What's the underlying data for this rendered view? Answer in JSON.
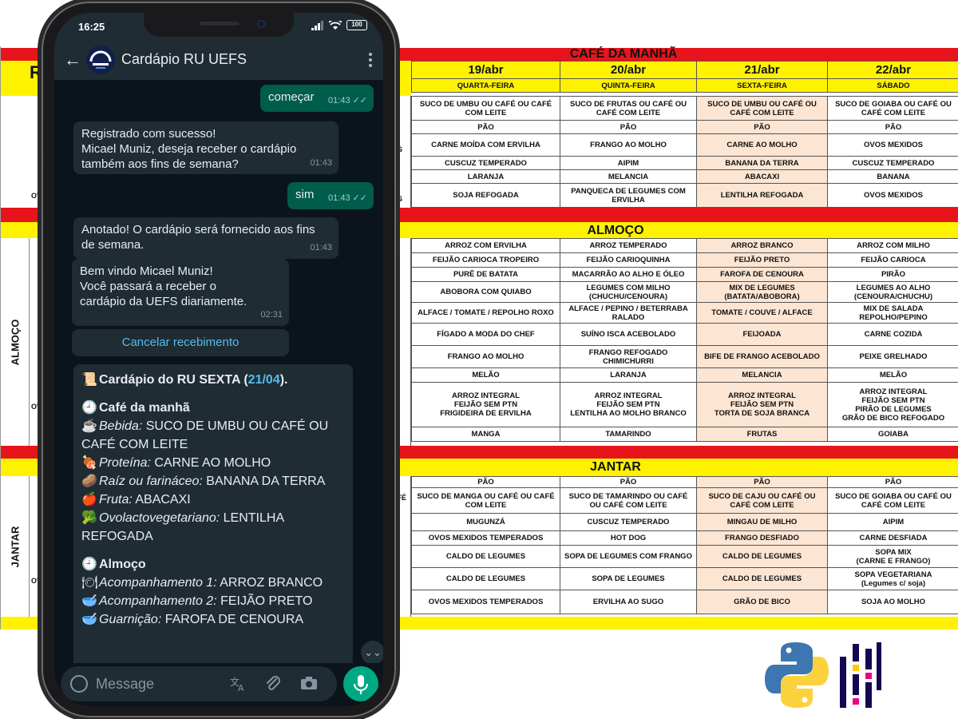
{
  "menu": {
    "r_letter": "R",
    "sections": {
      "breakfast": "CAFÉ DA MANHÃ",
      "lunch": "ALMOÇO",
      "dinner": "JANTAR"
    },
    "side_labels": {
      "lunch": "ALMOÇO",
      "dinner": "JANTAR"
    },
    "left_stubs": {
      "s1": "OS",
      "s2": "OS",
      "s3": "OV",
      "s4": "A",
      "s5": "OV",
      "s6": "AFÉ",
      "s7": "OV",
      "s8": "OV",
      "s9": "E"
    },
    "days": [
      {
        "date": "19/abr",
        "weekday": "QUARTA-FEIRA"
      },
      {
        "date": "20/abr",
        "weekday": "QUINTA-FEIRA"
      },
      {
        "date": "21/abr",
        "weekday": "SEXTA-FEIRA"
      },
      {
        "date": "22/abr",
        "weekday": "SÁBADO"
      }
    ],
    "breakfast_rows": [
      [
        "SUCO DE UMBU OU CAFÉ OU CAFÉ\nCOM LEITE",
        "SUCO DE FRUTAS OU CAFÉ OU\nCAFÉ COM LEITE",
        "SUCO DE UMBU OU CAFÉ OU\nCAFÉ COM LEITE",
        "SUCO DE GOIABA OU CAFÉ OU\nCAFÉ COM LEITE"
      ],
      [
        "PÃO",
        "PÃO",
        "PÃO",
        "PÃO"
      ],
      [
        "CARNE MOÍDA COM ERVILHA",
        "FRANGO AO MOLHO",
        "CARNE AO MOLHO",
        "OVOS MEXIDOS"
      ],
      [
        "CUSCUZ TEMPERADO",
        "AIPIM",
        "BANANA DA TERRA",
        "CUSCUZ TEMPERADO"
      ],
      [
        "LARANJA",
        "MELANCIA",
        "ABACAXI",
        "BANANA"
      ],
      [
        "SOJA REFOGADA",
        "PANQUECA DE LEGUMES COM\nERVILHA",
        "LENTILHA REFOGADA",
        "OVOS MEXIDOS"
      ]
    ],
    "lunch_rows": [
      [
        "ARROZ COM ERVILHA",
        "ARROZ TEMPERADO",
        "ARROZ BRANCO",
        "ARROZ COM MILHO"
      ],
      [
        "FEIJÃO CARIOCA TROPEIRO",
        "FEIJÃO CARIOQUINHA",
        "FEIJÃO PRETO",
        "FEIJÃO CARIOCA"
      ],
      [
        "PURÊ DE BATATA",
        "MACARRÃO AO ALHO E ÓLEO",
        "FAROFA DE CENOURA",
        "PIRÃO"
      ],
      [
        "ABOBORA COM QUIABO",
        "LEGUMES COM MILHO\n(CHUCHU/CENOURA)",
        "MIX DE LEGUMES\n(BATATA/ABOBORA)",
        "LEGUMES AO ALHO\n(CENOURA/CHUCHU)"
      ],
      [
        "ALFACE / TOMATE / REPOLHO ROXO",
        "ALFACE / PEPINO / BETERRABA\nRALADO",
        "TOMATE / COUVE / ALFACE",
        "MIX DE SALADA\nREPOLHO/PEPINO"
      ],
      [
        "FÍGADO A MODA DO CHEF",
        "SUÍNO ISCA ACEBOLADO",
        "FEIJOADA",
        "CARNE COZIDA"
      ],
      [
        "FRANGO AO MOLHO",
        "FRANGO REFOGADO\nCHIMICHURRI",
        "BIFE DE FRANGO ACEBOLADO",
        "PEIXE GRELHADO"
      ],
      [
        "MELÃO",
        "LARANJA",
        "MELANCIA",
        "MELÃO"
      ],
      [
        "ARROZ INTEGRAL\nFEIJÃO SEM PTN\nFRIGIDEIRA DE ERVILHA",
        "ARROZ INTEGRAL\nFEIJÃO SEM PTN\nLENTILHA AO MOLHO BRANCO",
        "ARROZ INTEGRAL\nFEIJÃO SEM PTN\nTORTA DE SOJA BRANCA",
        "ARROZ INTEGRAL\nFEIJÃO SEM PTN\nPIRÃO DE LEGUMES\nGRÃO DE BICO REFOGADO"
      ],
      [
        "MANGA",
        "TAMARINDO",
        "FRUTAS",
        "GOIABA"
      ]
    ],
    "dinner_rows": [
      [
        "PÃO",
        "PÃO",
        "PÃO",
        "PÃO"
      ],
      [
        "SUCO DE MANGA OU CAFÉ OU CAFÉ\nCOM LEITE",
        "SUCO DE TAMARINDO OU CAFÉ\nOU CAFÉ COM LEITE",
        "SUCO DE CAJU OU CAFÉ OU\nCAFÉ COM LEITE",
        "SUCO DE GOIABA OU CAFÉ OU\nCAFÉ COM LEITE"
      ],
      [
        "MUGUNZÁ",
        "CUSCUZ TEMPERADO",
        "MINGAU DE MILHO",
        "AIPIM"
      ],
      [
        "OVOS MEXIDOS TEMPERADOS",
        "HOT DOG",
        "FRANGO DESFIADO",
        "CARNE DESFIADA"
      ],
      [
        "CALDO DE LEGUMES",
        "SOPA DE LEGUMES COM FRANGO",
        "CALDO DE LEGUMES",
        "SOPA MIX\n(CARNE E FRANGO)"
      ],
      [
        "CALDO DE LEGUMES",
        "SOPA DE LEGUMES",
        "CALDO DE LEGUMES",
        "SOPA VEGETARIANA\n(Legumes c/ soja)"
      ],
      [
        "OVOS MEXIDOS TEMPERADOS",
        "ERVILHA AO SUGO",
        "GRÃO DE BICO",
        "SOJA AO MOLHO"
      ]
    ]
  },
  "phone": {
    "status": {
      "time": "16:25",
      "battery": "100"
    },
    "appbar": {
      "title": "Cardápio RU UEFS"
    },
    "messages": [
      {
        "dir": "out",
        "text": "começar",
        "time": "01:43"
      },
      {
        "dir": "in",
        "text": "Registrado com sucesso!\nMicael Muniz, deseja receber o cardápio\ntambém aos fins de semana?",
        "time": "01:43"
      },
      {
        "dir": "out",
        "text": "sim",
        "time": "01:43"
      },
      {
        "dir": "in",
        "text": "Anotado! O cardápio será fornecido aos fins\nde semana.",
        "time": "01:43"
      },
      {
        "dir": "in",
        "text": "Bem vindo Micael Muniz!\nVocê passará a receber o\ncardápio da UEFS diariamente.",
        "time": "02:31"
      }
    ],
    "cancel_button": "Cancelar recebimento",
    "menu_message": {
      "header_prefix": "Cardápio do RU SEXTA (",
      "header_date": "21/04",
      "header_suffix": ").",
      "breakfast_title": "Café da manhã",
      "lines_breakfast": [
        {
          "label": "Bebida:",
          "value": " SUCO DE UMBU OU CAFÉ OU CAFÉ COM LEITE"
        },
        {
          "label": "Proteína:",
          "value": " CARNE AO MOLHO"
        },
        {
          "label": "Raíz ou farináceo:",
          "value": " BANANA DA TERRA"
        },
        {
          "label": "Fruta:",
          "value": " ABACAXI"
        },
        {
          "label": "Ovolactovegetariano:",
          "value": " LENTILHA REFOGADA"
        }
      ],
      "lunch_title": "Almoço",
      "lines_lunch": [
        {
          "label": "Acompanhamento 1:",
          "value": " ARROZ BRANCO"
        },
        {
          "label": "Acompanhamento 2:",
          "value": " FEIJÃO PRETO"
        },
        {
          "label": "Guarnição:",
          "value": " FAROFA DE CENOURA"
        }
      ]
    },
    "composer": {
      "placeholder": "Message"
    }
  },
  "icons": {
    "breakfast_emojis": [
      "☕",
      "🍖",
      "🥔",
      "🍎",
      "🥦"
    ],
    "lunch_emojis": [
      "🍽",
      "🥣",
      "🥣"
    ],
    "scroll": "⌄⌄",
    "clock": "🕘",
    "scroll_icon": "📜"
  },
  "colors": {
    "whatsapp_dark": "#0b141a",
    "bubble_in": "#1f2c34",
    "bubble_out": "#005c4b",
    "accent": "#00a884",
    "menu_red": "#e8141c",
    "menu_yellow": "#fff200",
    "highlight": "#fde5d3"
  }
}
